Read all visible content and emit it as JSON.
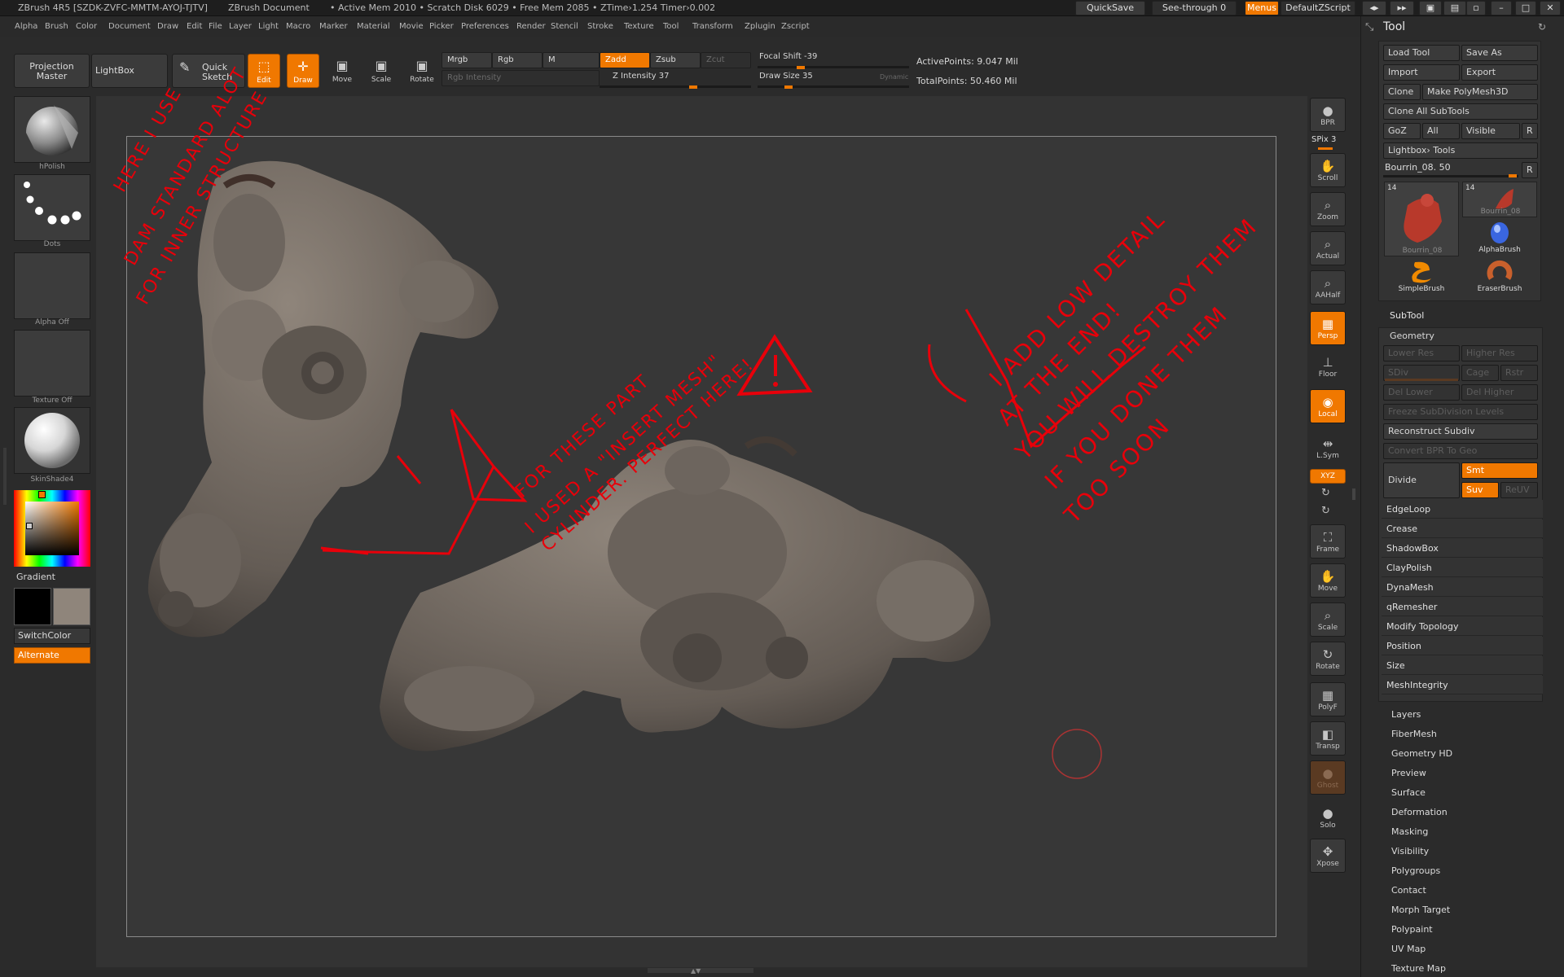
{
  "titlebar": {
    "app": "ZBrush 4R5 [SZDK-ZVFC-MMTM-AYOJ-TJTV]",
    "doc": "ZBrush Document",
    "stats": "• Active Mem 2010 • Scratch Disk 6029 • Free Mem 2085 • ZTime›1.254 Timer›0.002",
    "quicksave": "QuickSave",
    "seethrough": "See-through  0",
    "menus": "Menus",
    "script": "DefaultZScript"
  },
  "menubar": [
    "Alpha",
    "Brush",
    "Color",
    "Document",
    "Draw",
    "Edit",
    "File",
    "Layer",
    "Light",
    "Macro",
    "Marker",
    "Material",
    "Movie",
    "Picker",
    "Preferences",
    "Render",
    "Stencil",
    "Stroke",
    "Texture",
    "Tool",
    "Transform",
    "Zplugin",
    "Zscript"
  ],
  "shelf": {
    "projection_master": "Projection Master",
    "lightbox": "LightBox",
    "quick_sketch": "Quick Sketch",
    "edit": "Edit",
    "draw": "Draw",
    "move": "Move",
    "scale": "Scale",
    "rotate": "Rotate",
    "mrgb": "Mrgb",
    "rgb": "Rgb",
    "m": "M",
    "rgb_intensity": "Rgb Intensity",
    "zadd": "Zadd",
    "zsub": "Zsub",
    "zcut": "Zcut",
    "z_intensity": "Z Intensity 37",
    "focal_shift": "Focal Shift -39",
    "draw_size": "Draw Size 35",
    "dynamic": "Dynamic",
    "active_points": "ActivePoints: 9.047 Mil",
    "total_points": "TotalPoints: 50.460 Mil"
  },
  "leftpal": {
    "brush_label": "hPolish",
    "stroke_label": "Dots",
    "alpha_label": "Alpha  Off",
    "texture_label": "Texture  Off",
    "material_label": "SkinShade4",
    "gradient": "Gradient",
    "switchcolor": "SwitchColor",
    "alternate": "Alternate",
    "colors": {
      "primary": "#000000",
      "secondary": "#8f857b",
      "accent": "#f07800"
    }
  },
  "annotations": {
    "a1": [
      "HERE I USE",
      "DAM STANDARD ALOT",
      "FOR INNER STRUCTURE"
    ],
    "a2": [
      "FOR THESE PART",
      "I USED A \"INSERT MESH\"",
      "CYLINDER. PERFECT HERE!"
    ],
    "a3": [
      "I ADD LOW DETAIL",
      "AT THE END!",
      "YOU WILL DESTROY THEM",
      "IF YOU DONE THEM",
      "TOO SOON"
    ]
  },
  "rightbar": {
    "bpr": "BPR",
    "spix": "SPix 3",
    "scroll": "Scroll",
    "zoom": "Zoom",
    "actual": "Actual",
    "aahalf": "AAHalf",
    "persp": "Persp",
    "floor": "Floor",
    "local": "Local",
    "lsym": "L.Sym",
    "xyz": "XYZ",
    "frame": "Frame",
    "move": "Move",
    "scale": "Scale",
    "rotate": "Rotate",
    "polyf": "PolyF",
    "transp": "Transp",
    "ghost": "Ghost",
    "solo": "Solo",
    "xpose": "Xpose"
  },
  "toolpanel": {
    "title": "Tool",
    "load_tool": "Load Tool",
    "save_as": "Save As",
    "import": "Import",
    "export": "Export",
    "clone": "Clone",
    "make_polymesh": "Make PolyMesh3D",
    "clone_all": "Clone  All  SubTools",
    "goz": "GoZ",
    "all": "All",
    "visible": "Visible",
    "r": "R",
    "lightbox_tools": "Lightbox› Tools",
    "current_tool": "Bourrin_08. 50",
    "thumb_count_1": "14",
    "thumb_count_2": "14",
    "thumb1": "Bourrin_08",
    "thumb2": "Bourrin_08",
    "alphabrush": "AlphaBrush",
    "simplebrush": "SimpleBrush",
    "eraserbrush": "EraserBrush",
    "subtool": "SubTool",
    "geometry": "Geometry",
    "lower_res": "Lower Res",
    "higher_res": "Higher Res",
    "sdiv": "SDiv",
    "cage": "Cage",
    "rstr": "Rstr",
    "del_lower": "Del Lower",
    "del_higher": "Del Higher",
    "freeze": "Freeze SubDivision Levels",
    "reconstruct": "Reconstruct Subdiv",
    "convert_bpr": "Convert BPR To Geo",
    "divide": "Divide",
    "smt": "Smt",
    "suv": "Suv",
    "reuv": "ReUV",
    "geometry_items": [
      "EdgeLoop",
      "Crease",
      "ShadowBox",
      "ClayPolish",
      "DynaMesh",
      "qRemesher",
      "Modify Topology",
      "Position",
      "Size",
      "MeshIntegrity"
    ],
    "sections": [
      "Layers",
      "FiberMesh",
      "Geometry HD",
      "Preview",
      "Surface",
      "Deformation",
      "Masking",
      "Visibility",
      "Polygroups",
      "Contact",
      "Morph Target",
      "Polypaint",
      "UV Map",
      "Texture Map"
    ]
  }
}
